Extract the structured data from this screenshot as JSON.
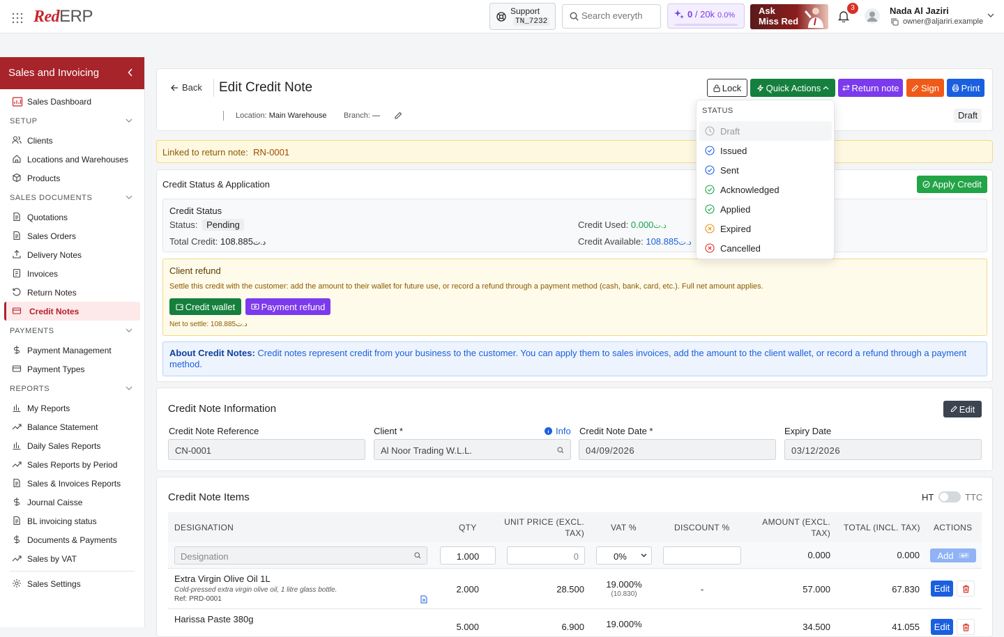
{
  "topbar": {
    "logo_red": "Red",
    "logo_erp": "ERP",
    "support_label": "Support",
    "support_code": "TN_7232",
    "search_placeholder": "Search everyth",
    "credits_used": "0",
    "credits_total": "/ 20k",
    "credits_percent": "0.0%",
    "credits_fraction": 0.0,
    "ask_line1": "Ask",
    "ask_line2": "Miss Red",
    "notifications_count": "3",
    "user_name": "Nada Al Jaziri",
    "user_email": "owner@aljariri.example"
  },
  "sidebar": {
    "title": "Sales and Invoicing",
    "dashboard": "Sales Dashboard",
    "sections": {
      "setup": "SETUP",
      "sales_documents": "SALES DOCUMENTS",
      "payments": "PAYMENTS",
      "reports": "REPORTS"
    },
    "setup_items": [
      "Clients",
      "Locations and Warehouses",
      "Products"
    ],
    "doc_items": [
      "Quotations",
      "Sales Orders",
      "Delivery Notes",
      "Invoices",
      "Return Notes",
      "Credit Notes"
    ],
    "payment_items": [
      "Payment Management",
      "Payment Types"
    ],
    "report_items": [
      "My Reports",
      "Balance Statement",
      "Daily Sales Reports",
      "Sales Reports by Period",
      "Sales & Invoices Reports",
      "Journal Caisse",
      "BL invoicing status",
      "Documents & Payments",
      "Sales by VAT"
    ],
    "settings": "Sales Settings"
  },
  "header": {
    "back": "Back",
    "title": "Edit Credit Note",
    "location_label": "Location:",
    "location_value": "Main Warehouse",
    "branch_label": "Branch:",
    "branch_value": "—",
    "status_badge": "Draft",
    "buttons": {
      "lock": "Lock",
      "quick_actions": "Quick Actions",
      "return_note": "Return note",
      "sign": "Sign",
      "print": "Print"
    }
  },
  "status_menu": {
    "heading": "STATUS",
    "items": [
      "Draft",
      "Issued",
      "Sent",
      "Acknowledged",
      "Applied",
      "Expired",
      "Cancelled"
    ]
  },
  "linked": {
    "label": "Linked to return note:",
    "value": "RN-0001"
  },
  "credit_status": {
    "card_title": "Credit Status & Application",
    "apply_button": "Apply Credit",
    "box_title": "Credit Status",
    "status_label": "Status:",
    "status_value": "Pending",
    "total_label": "Total Credit:",
    "total_value": "108.885",
    "used_label": "Credit Used:",
    "used_value": "0.000",
    "available_label": "Credit Available:",
    "available_value": "108.885",
    "currency": "د.ت"
  },
  "refund": {
    "title": "Client refund",
    "description": "Settle this credit with the customer: add the amount to their wallet for future use, or record a refund through a payment method (cash, bank, card, etc.). Full net amount applies.",
    "wallet_button": "Credit wallet",
    "payment_button": "Payment refund",
    "net_label": "Net to settle:",
    "net_value": "108.885"
  },
  "about": {
    "label": "About Credit Notes:",
    "text": "Credit notes represent credit from your business to the customer. You can apply them to sales invoices, add the amount to the client wallet, or record a refund through a payment method."
  },
  "info": {
    "title": "Credit Note Information",
    "edit_button": "Edit",
    "reference_label": "Credit Note Reference",
    "reference_value": "CN-0001",
    "client_label": "Client *",
    "client_info_link": "Info",
    "client_value": "Al Noor Trading W.L.L.",
    "date_label": "Credit Note Date *",
    "date_value": "04/09/2026",
    "expiry_label": "Expiry Date",
    "expiry_value": "03/12/2026"
  },
  "items": {
    "title": "Credit Note Items",
    "toggle_left": "HT",
    "toggle_right": "TTC",
    "columns": {
      "designation": "DESIGNATION",
      "qty": "QTY",
      "unit_price_1": "UNIT PRICE (EXCL.",
      "unit_price_2": "TAX)",
      "vat": "VAT %",
      "discount": "DISCOUNT %",
      "amount_1": "AMOUNT (EXCL.",
      "amount_2": "TAX)",
      "total": "TOTAL (INCL. TAX)",
      "actions": "ACTIONS"
    },
    "new_row": {
      "designation_placeholder": "Designation",
      "qty": "1.000",
      "unit_price": "0",
      "vat": "0%",
      "amount": "0.000",
      "total": "0.000",
      "add_button": "Add"
    },
    "rows": [
      {
        "name": "Extra Virgin Olive Oil 1L",
        "description": "Cold-pressed extra virgin olive oil, 1 litre glass bottle.",
        "ref": "Ref: PRD-0001",
        "qty": "2.000",
        "unit_price": "28.500",
        "vat": "19.000%",
        "vat_amount": "(10.830)",
        "discount": "-",
        "amount": "57.000",
        "total": "67.830",
        "edit": "Edit"
      },
      {
        "name": "Harissa Paste 380g",
        "qty": "5.000",
        "unit_price": "6.900",
        "vat": "19.000%",
        "amount": "34.500",
        "total": "41.055",
        "edit": "Edit"
      }
    ]
  },
  "colors": {
    "brand": "#a7242a",
    "green": "#15803d",
    "purple": "#7c3aed",
    "orange": "#f05a18",
    "blue": "#1a5fe0"
  }
}
